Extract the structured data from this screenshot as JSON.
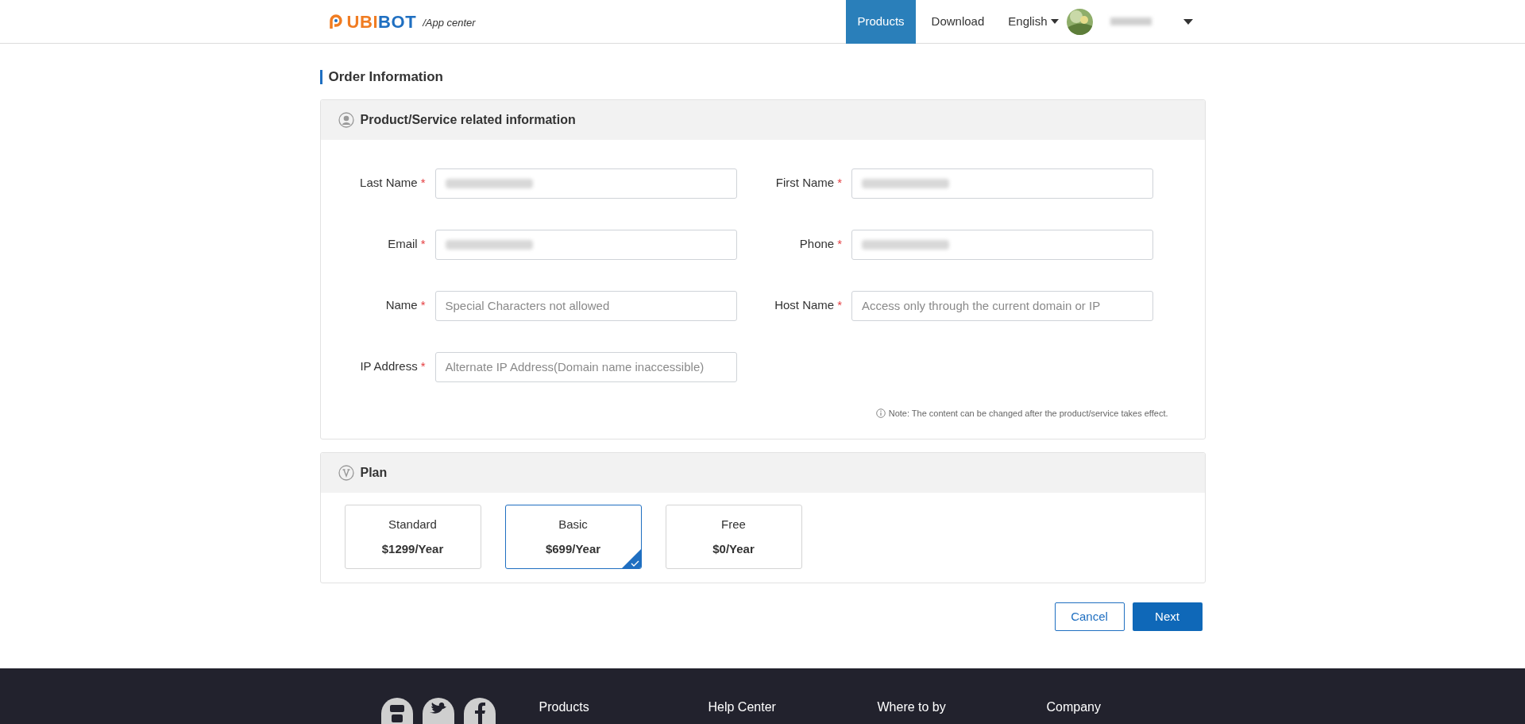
{
  "header": {
    "logo": {
      "brand_part_1": "UBI",
      "brand_part_2": "BOT",
      "subtitle": "/App center"
    },
    "nav": [
      {
        "label": "Products",
        "selected": true
      },
      {
        "label": "Download",
        "selected": false
      }
    ],
    "language": {
      "label": "English"
    }
  },
  "page_title": "Order Information",
  "info_section": {
    "title": "Product/Service related information",
    "fields": [
      {
        "label": "Last Name",
        "required_mark": "*",
        "filled": true
      },
      {
        "label": "First Name",
        "required_mark": "*",
        "filled": true
      },
      {
        "label": "Email",
        "required_mark": "*",
        "filled": true
      },
      {
        "label": "Phone",
        "required_mark": "*",
        "filled": true
      },
      {
        "label": "Name",
        "required_mark": "*",
        "placeholder": "Special Characters not allowed",
        "filled": false
      },
      {
        "label": "Host Name",
        "required_mark": "*",
        "placeholder": "Access only through the current domain or IP",
        "filled": false
      },
      {
        "label": "IP Address",
        "required_mark": "*",
        "placeholder": "Alternate IP Address(Domain name inaccessible)",
        "filled": false
      }
    ],
    "note": "Note: The content can be changed after the product/service takes effect."
  },
  "plan_section": {
    "title": "Plan",
    "plans": [
      {
        "name": "Standard",
        "price": "$1299/Year",
        "selected": false
      },
      {
        "name": "Basic",
        "price": "$699/Year",
        "selected": true
      },
      {
        "name": "Free",
        "price": "$0/Year",
        "selected": false
      }
    ]
  },
  "buttons": {
    "cancel": "Cancel",
    "next": "Next"
  },
  "footer": {
    "columns": [
      "Products",
      "Help Center",
      "Where to by",
      "Company"
    ]
  }
}
